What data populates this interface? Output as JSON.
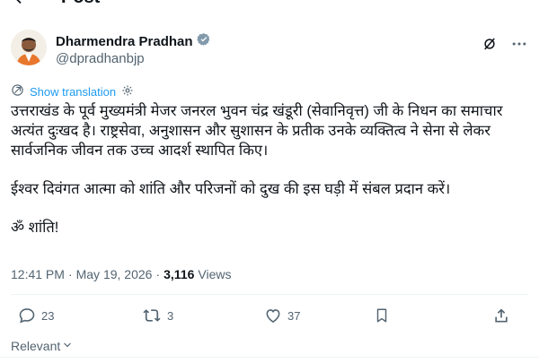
{
  "header": {
    "title": "Post"
  },
  "author": {
    "name": "Dharmendra Pradhan",
    "handle": "@dpradhanbjp",
    "verified": true
  },
  "translation": {
    "label": "Show translation"
  },
  "post": {
    "paragraphs": [
      "उत्तराखंड के पूर्व मुख्यमंत्री मेजर जनरल भुवन चंद्र खंडूरी (सेवानिवृत्त) जी के निधन का समाचार अत्यंत दुःखद है। राष्ट्रसेवा, अनुशासन और सुशासन के प्रतीक उनके व्यक्तित्व ने सेना से लेकर सार्वजनिक जीवन तक उच्च आदर्श स्थापित किए।",
      "ईश्वर दिवंगत आत्मा को शांति और परिजनों को दुख की इस घड़ी में संबल प्रदान करें।",
      "ॐ शांति!"
    ],
    "time": "12:41 PM",
    "separator": "·",
    "date": "May 19, 2026",
    "views_count": "3,116",
    "views_label": "Views"
  },
  "actions": {
    "replies": "23",
    "reposts": "3",
    "likes": "37"
  },
  "footer": {
    "relevant_label": "Relevant"
  },
  "colors": {
    "accent": "#1d9bf0",
    "muted": "#536471",
    "text": "#0f1419"
  }
}
